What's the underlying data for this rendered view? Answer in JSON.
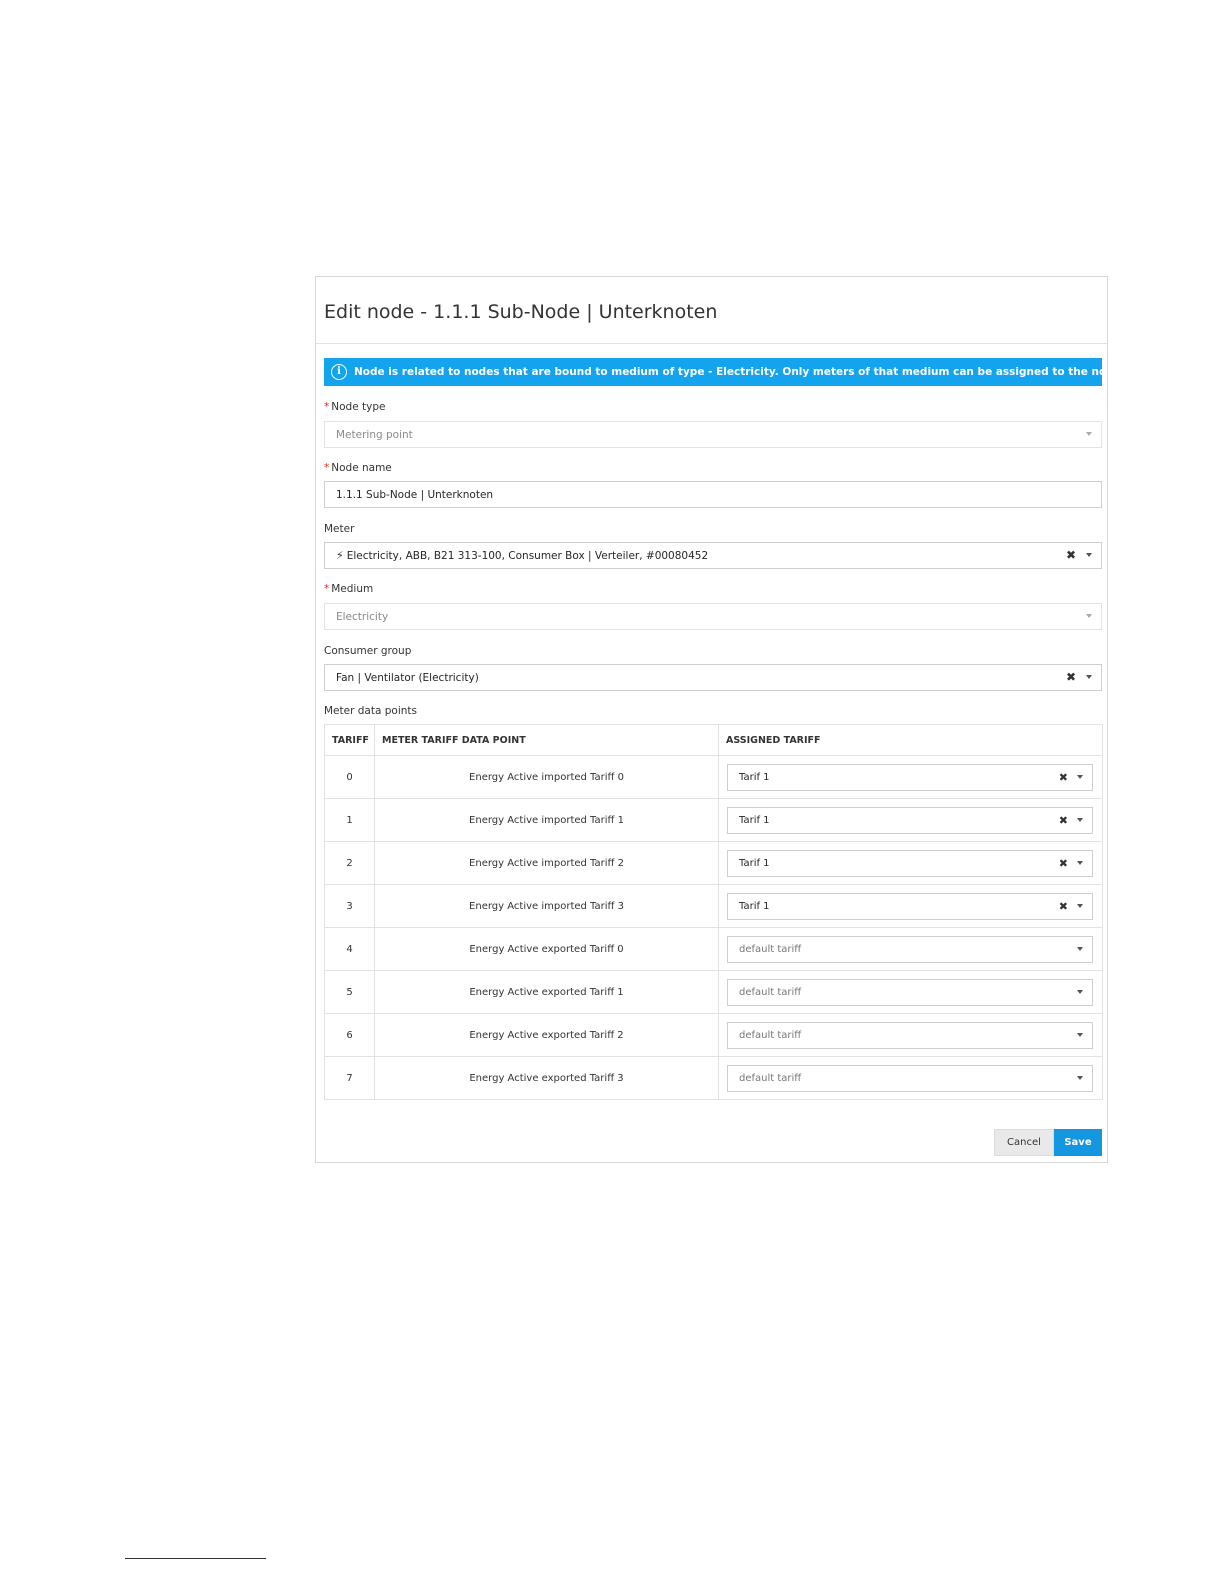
{
  "dialog": {
    "title": "Edit node - 1.1.1 Sub-Node | Unterknoten",
    "info_banner": "Node is related to nodes that are bound to medium of type - Electricity. Only meters of that medium can be assigned to the node.",
    "info_icon": "i"
  },
  "form": {
    "node_type": {
      "label": "Node type",
      "required": "*",
      "value": "Metering point"
    },
    "node_name": {
      "label": "Node name",
      "required": "*",
      "value": "1.1.1 Sub-Node | Unterknoten"
    },
    "meter": {
      "label": "Meter",
      "value": "Electricity, ABB, B21 313-100, Consumer Box | Verteiler, #00080452"
    },
    "medium": {
      "label": "Medium",
      "required": "*",
      "value": "Electricity"
    },
    "consumer_group": {
      "label": "Consumer group",
      "value": "Fan | Ventilator (Electricity)"
    }
  },
  "data_points": {
    "label": "Meter data points",
    "columns": [
      "TARIFF",
      "METER TARIFF DATA POINT",
      "ASSIGNED TARIFF"
    ],
    "rows": [
      {
        "tariff": "0",
        "data_point": "Energy Active imported Tariff 0",
        "assigned": "Tarif 1"
      },
      {
        "tariff": "1",
        "data_point": "Energy Active imported Tariff 1",
        "assigned": "Tarif 1"
      },
      {
        "tariff": "2",
        "data_point": "Energy Active imported Tariff 2",
        "assigned": "Tarif 1"
      },
      {
        "tariff": "3",
        "data_point": "Energy Active imported Tariff 3",
        "assigned": "Tarif 1"
      },
      {
        "tariff": "4",
        "data_point": "Energy Active exported Tariff 0",
        "assigned": "default tariff"
      },
      {
        "tariff": "5",
        "data_point": "Energy Active exported Tariff 1",
        "assigned": "default tariff"
      },
      {
        "tariff": "6",
        "data_point": "Energy Active exported Tariff 2",
        "assigned": "default tariff"
      },
      {
        "tariff": "7",
        "data_point": "Energy Active exported Tariff 3",
        "assigned": "default tariff"
      }
    ]
  },
  "buttons": {
    "cancel": "Cancel",
    "save": "Save"
  },
  "icons": {
    "clear": "✖",
    "bolt": "⚡"
  },
  "colors": {
    "accent": "#14a4ee",
    "save": "#1596e0",
    "required": "#e0261b"
  }
}
